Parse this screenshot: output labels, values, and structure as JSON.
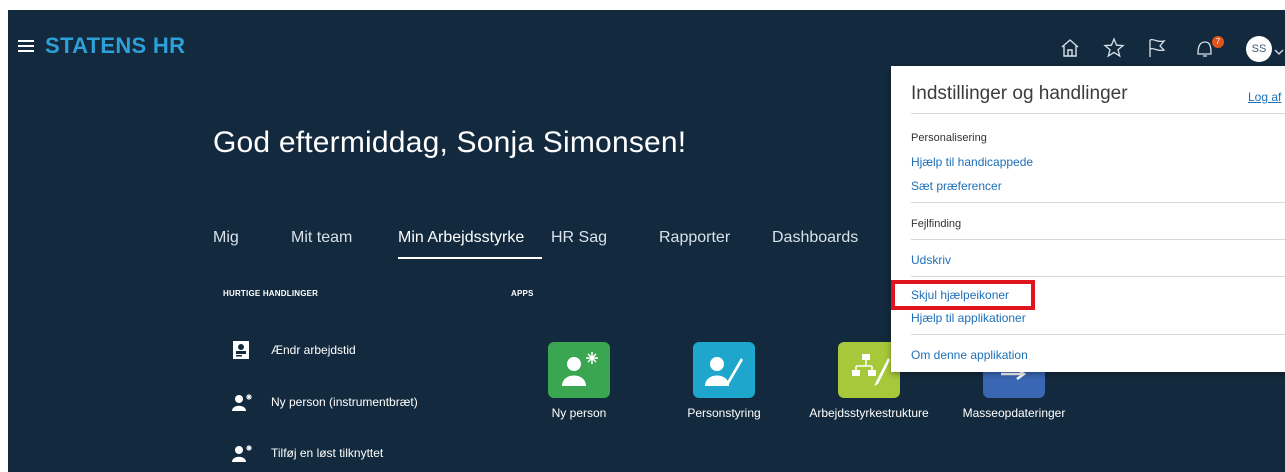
{
  "header": {
    "brand": "STATENS HR",
    "notification_count": "7",
    "user_initials": "SS",
    "icons": [
      "home-icon",
      "star-icon",
      "flag-icon",
      "notifications-icon"
    ]
  },
  "greeting": "God eftermiddag, Sonja Simonsen!",
  "tabs": [
    {
      "label": "Mig"
    },
    {
      "label": "Mit team"
    },
    {
      "label": "Min Arbejdsstyrke",
      "active": true
    },
    {
      "label": "HR Sag"
    },
    {
      "label": "Rapporter"
    },
    {
      "label": "Dashboards"
    }
  ],
  "quick_actions": {
    "heading": "HURTIGE HANDLINGER",
    "items": [
      {
        "label": "Ændr arbejdstid",
        "icon": "badge-icon"
      },
      {
        "label": "Ny person (instrumentbræt)",
        "icon": "new-person-icon"
      },
      {
        "label": "Tilføj en løst tilknyttet",
        "icon": "new-person-icon"
      }
    ]
  },
  "apps": {
    "heading": "APPS",
    "items": [
      {
        "label": "Ny person",
        "color": "#3aa651",
        "icon": "new-person-icon"
      },
      {
        "label": "Personstyring",
        "color": "#1fa6cc",
        "icon": "person-edit-icon"
      },
      {
        "label": "Arbejdsstyrkestrukture",
        "color": "#a6c83a",
        "icon": "org-structure-icon"
      },
      {
        "label": "Masseopdateringer",
        "color": "#3a67b4",
        "icon": "mass-update-icon"
      }
    ]
  },
  "settings_panel": {
    "title": "Indstillinger og handlinger",
    "sign_out": "Log af",
    "groups": [
      {
        "heading": "Personalisering",
        "links": [
          "Hjælp til handicappede",
          "Sæt præferencer"
        ]
      },
      {
        "heading": "Fejlfinding",
        "links": []
      }
    ],
    "links_other": [
      "Udskriv",
      "Skjul hjælpeikoner",
      "Hjælp til applikationer",
      "Om denne applikation"
    ],
    "highlight_color": "#e0141e"
  },
  "colors": {
    "background": "#132a3e",
    "brand": "#2e9fd8",
    "link": "#1d6fb8"
  }
}
